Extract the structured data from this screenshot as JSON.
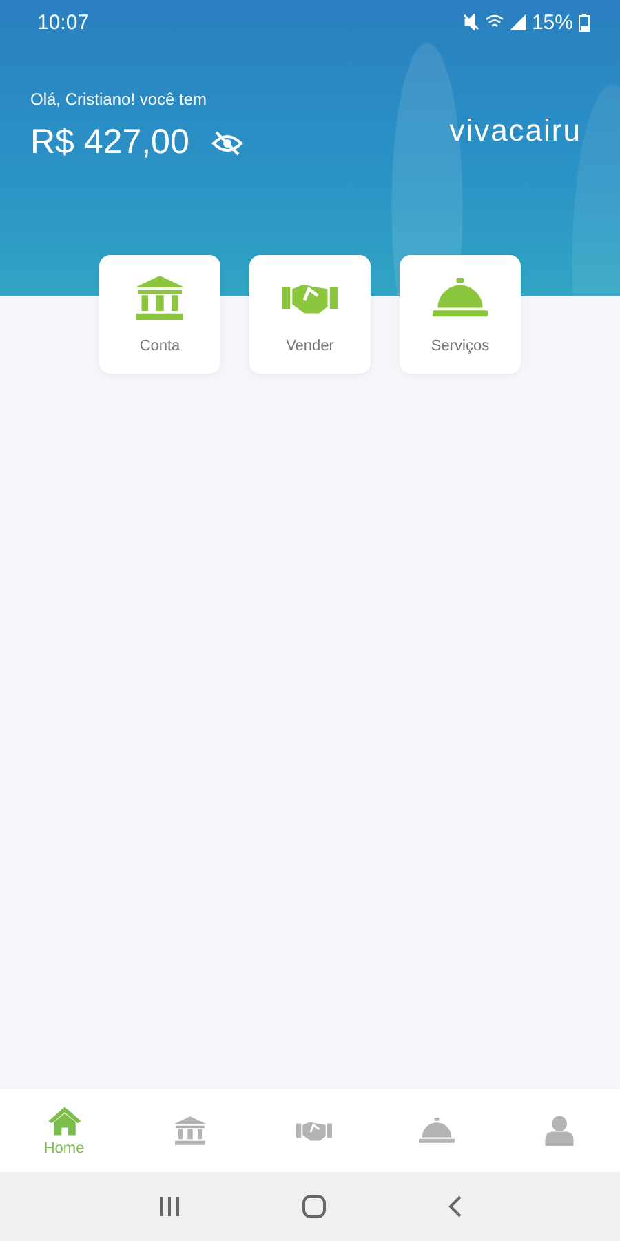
{
  "status_bar": {
    "time": "10:07",
    "battery": "15%"
  },
  "header": {
    "greeting": "Olá, Cristiano! você tem",
    "balance": "R$ 427,00",
    "logo": "vivacairu"
  },
  "shortcuts": [
    {
      "kind": "bank",
      "label": "Conta"
    },
    {
      "kind": "handshake",
      "label": "Vender"
    },
    {
      "kind": "bell",
      "label": "Serviços"
    }
  ],
  "bottom_nav": [
    {
      "kind": "home",
      "label": "Home",
      "selected": true
    },
    {
      "kind": "bank",
      "selected": false
    },
    {
      "kind": "handshake",
      "selected": false
    },
    {
      "kind": "bell",
      "selected": false
    },
    {
      "kind": "person",
      "selected": false
    }
  ]
}
